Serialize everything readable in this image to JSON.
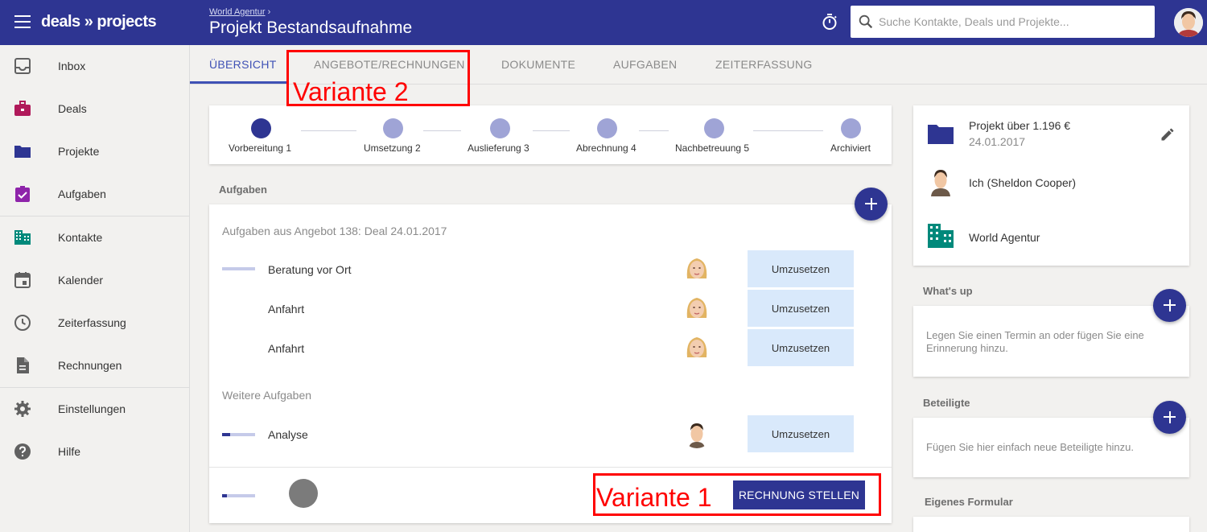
{
  "app": {
    "logo": "deals » projects",
    "breadcrumb": "World Agentur",
    "breadcrumb_sep": "›",
    "title": "Projekt Bestandsaufnahme",
    "search_placeholder": "Suche Kontakte, Deals und Projekte..."
  },
  "sidebar": {
    "items": [
      {
        "label": "Inbox",
        "icon": "inbox-icon"
      },
      {
        "label": "Deals",
        "icon": "briefcase-icon"
      },
      {
        "label": "Projekte",
        "icon": "folder-icon"
      },
      {
        "label": "Aufgaben",
        "icon": "clipboard-check-icon"
      },
      {
        "label": "Kontakte",
        "icon": "building-icon"
      },
      {
        "label": "Kalender",
        "icon": "calendar-icon"
      },
      {
        "label": "Zeiterfassung",
        "icon": "clock-icon"
      },
      {
        "label": "Rechnungen",
        "icon": "document-icon"
      },
      {
        "label": "Einstellungen",
        "icon": "gear-icon"
      },
      {
        "label": "Hilfe",
        "icon": "help-icon"
      }
    ]
  },
  "tabs": [
    {
      "label": "ÜBERSICHT",
      "active": true
    },
    {
      "label": "ANGEBOTE/RECHNUNGEN",
      "active": false
    },
    {
      "label": "DOKUMENTE",
      "active": false
    },
    {
      "label": "AUFGABEN",
      "active": false
    },
    {
      "label": "ZEITERFASSUNG",
      "active": false
    }
  ],
  "stepper": [
    {
      "label": "Vorbereitung 1",
      "done": true
    },
    {
      "label": "Umsetzung 2",
      "done": false
    },
    {
      "label": "Auslieferung 3",
      "done": false
    },
    {
      "label": "Abrechnung 4",
      "done": false
    },
    {
      "label": "Nachbetreuung 5",
      "done": false
    },
    {
      "label": "Archiviert",
      "done": false
    }
  ],
  "tasks": {
    "section_title": "Aufgaben",
    "group1_title": "Aufgaben aus Angebot 138: Deal 24.01.2017",
    "group1": [
      {
        "name": "Beratung vor Ort",
        "status": "Umzusetzen",
        "progress": 0
      },
      {
        "name": "Anfahrt",
        "status": "Umzusetzen"
      },
      {
        "name": "Anfahrt",
        "status": "Umzusetzen"
      }
    ],
    "group2_title": "Weitere Aufgaben",
    "group2": [
      {
        "name": "Analyse",
        "status": "Umzusetzen",
        "progress": 0.25
      }
    ],
    "footer_progress": 0.15,
    "invoice_button": "RECHNUNG STELLEN"
  },
  "annotations": {
    "variant1": "Variante  1",
    "variant2": "Variante  2"
  },
  "project_info": {
    "title": "Projekt über 1.196 €",
    "date": "24.01.2017",
    "owner": "Ich (Sheldon Cooper)",
    "company": "World Agentur"
  },
  "whats_up": {
    "title": "What's up",
    "hint": "Legen Sie einen Termin an oder fügen Sie eine Erinnerung hinzu."
  },
  "beteiligte": {
    "title": "Beteiligte",
    "hint": "Fügen Sie hier einfach neue Beteiligte hinzu."
  },
  "eigenes_formular": {
    "title": "Eigenes Formular"
  },
  "colors": {
    "primary": "#2e3592",
    "step_inactive": "#9fa4d6",
    "status_bg": "#d9e9fb",
    "annotation": "#ff0000"
  }
}
